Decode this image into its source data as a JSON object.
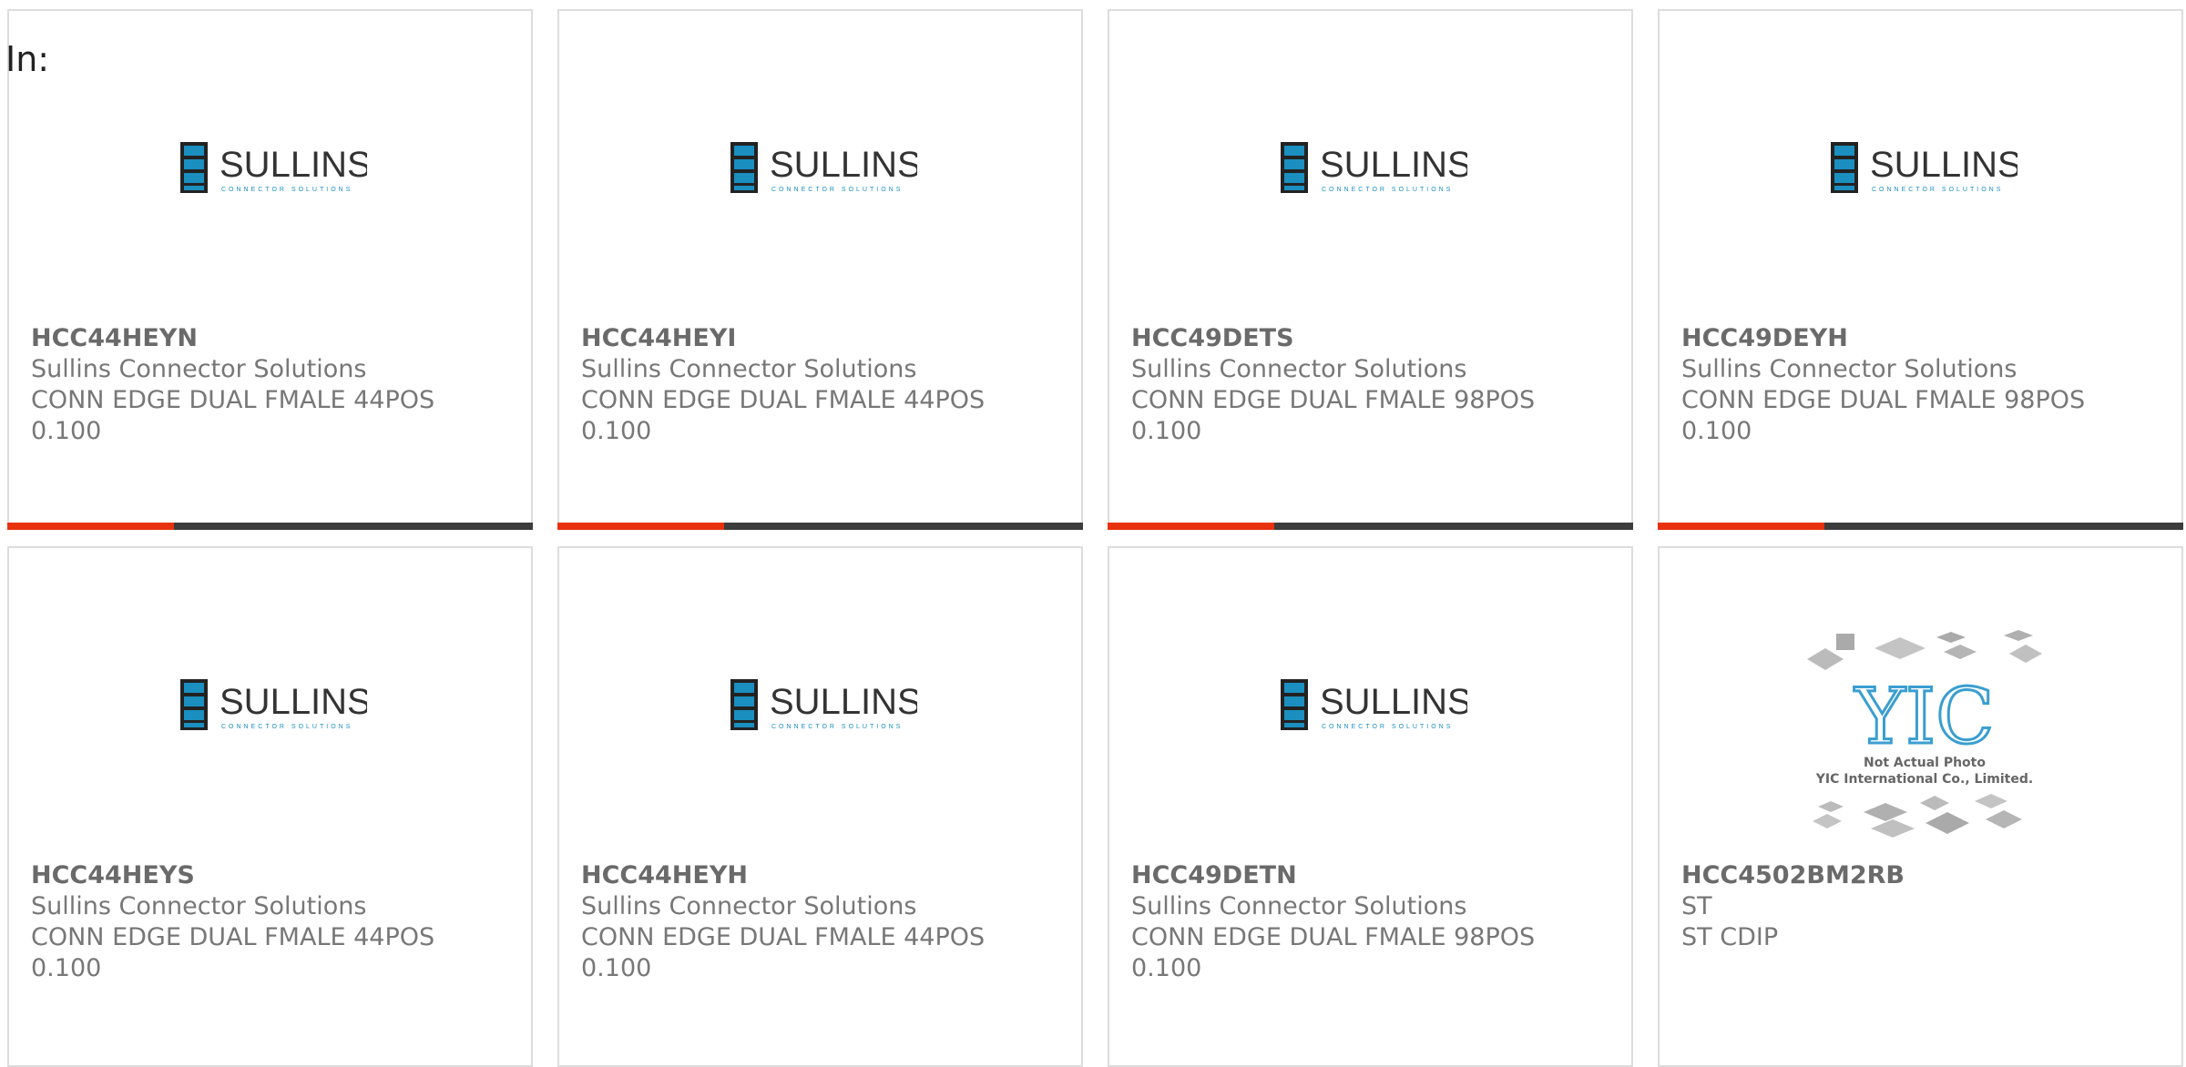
{
  "heading": {
    "label": "In:"
  },
  "colors": {
    "accent": "#e8320f",
    "bar": "#3c3c3c",
    "border": "#dddddd",
    "text": "#777777",
    "sullins_blue": "#1a8fc0"
  },
  "sullins_logo": {
    "word": "SULLINS",
    "tagline": "CONNECTOR SOLUTIONS"
  },
  "yic_logo": {
    "mark": "YIC",
    "line1": "Not Actual Photo",
    "line2": "YIC International Co., Limited."
  },
  "products": [
    {
      "part": "HCC44HEYN",
      "manufacturer": "Sullins Connector Solutions",
      "desc1": "CONN EDGE DUAL FMALE 44POS",
      "desc2": "0.100",
      "image": "sullins-logo"
    },
    {
      "part": "HCC44HEYI",
      "manufacturer": "Sullins Connector Solutions",
      "desc1": "CONN EDGE DUAL FMALE 44POS",
      "desc2": "0.100",
      "image": "sullins-logo"
    },
    {
      "part": "HCC49DETS",
      "manufacturer": "Sullins Connector Solutions",
      "desc1": "CONN EDGE DUAL FMALE 98POS",
      "desc2": "0.100",
      "image": "sullins-logo"
    },
    {
      "part": "HCC49DEYH",
      "manufacturer": "Sullins Connector Solutions",
      "desc1": "CONN EDGE DUAL FMALE 98POS",
      "desc2": "0.100",
      "image": "sullins-logo"
    },
    {
      "part": "HCC44HEYS",
      "manufacturer": "Sullins Connector Solutions",
      "desc1": "CONN EDGE DUAL FMALE 44POS",
      "desc2": "0.100",
      "image": "sullins-logo"
    },
    {
      "part": "HCC44HEYH",
      "manufacturer": "Sullins Connector Solutions",
      "desc1": "CONN EDGE DUAL FMALE 44POS",
      "desc2": "0.100",
      "image": "sullins-logo"
    },
    {
      "part": "HCC49DETN",
      "manufacturer": "Sullins Connector Solutions",
      "desc1": "CONN EDGE DUAL FMALE 98POS",
      "desc2": "0.100",
      "image": "sullins-logo"
    },
    {
      "part": "HCC4502BM2RB",
      "manufacturer": "ST",
      "desc1": "ST CDIP",
      "image": "yic-placeholder"
    }
  ]
}
